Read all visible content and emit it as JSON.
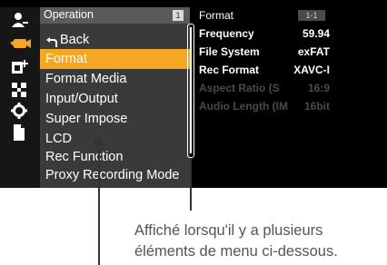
{
  "icons": [
    "user-icon",
    "camera-icon",
    "media-icon",
    "grid-icon",
    "gear-icon",
    "file-icon"
  ],
  "menu": {
    "header_title": "Operation",
    "page": "1",
    "back_label": "Back",
    "items": [
      {
        "label": "Format",
        "selected": true
      },
      {
        "label": "Format Media"
      },
      {
        "label": "Input/Output"
      },
      {
        "label": "Super Impose"
      },
      {
        "label": "LCD"
      },
      {
        "label": "Rec Function"
      },
      {
        "label": "Proxy Recording Mode"
      }
    ]
  },
  "info": {
    "title": "Format",
    "page": "1-1",
    "rows": [
      {
        "key": "Frequency",
        "value": "59.94",
        "enabled": true
      },
      {
        "key": "File System",
        "value": "exFAT",
        "enabled": true
      },
      {
        "key": "Rec Format",
        "value": "XAVC-I",
        "enabled": true
      },
      {
        "key": "Aspect Ratio (S",
        "value": "16:9",
        "enabled": false
      },
      {
        "key": "Audio Length (IM",
        "value": "16bit",
        "enabled": false
      }
    ]
  },
  "caption": {
    "line1": "Affiché lorsqu'il y a plusieurs",
    "line2": "éléments de menu ci-dessous."
  },
  "colors": {
    "highlight": "#f5a623",
    "icon_active": "#f5a623",
    "disabled_text": "#4a4a4a"
  }
}
